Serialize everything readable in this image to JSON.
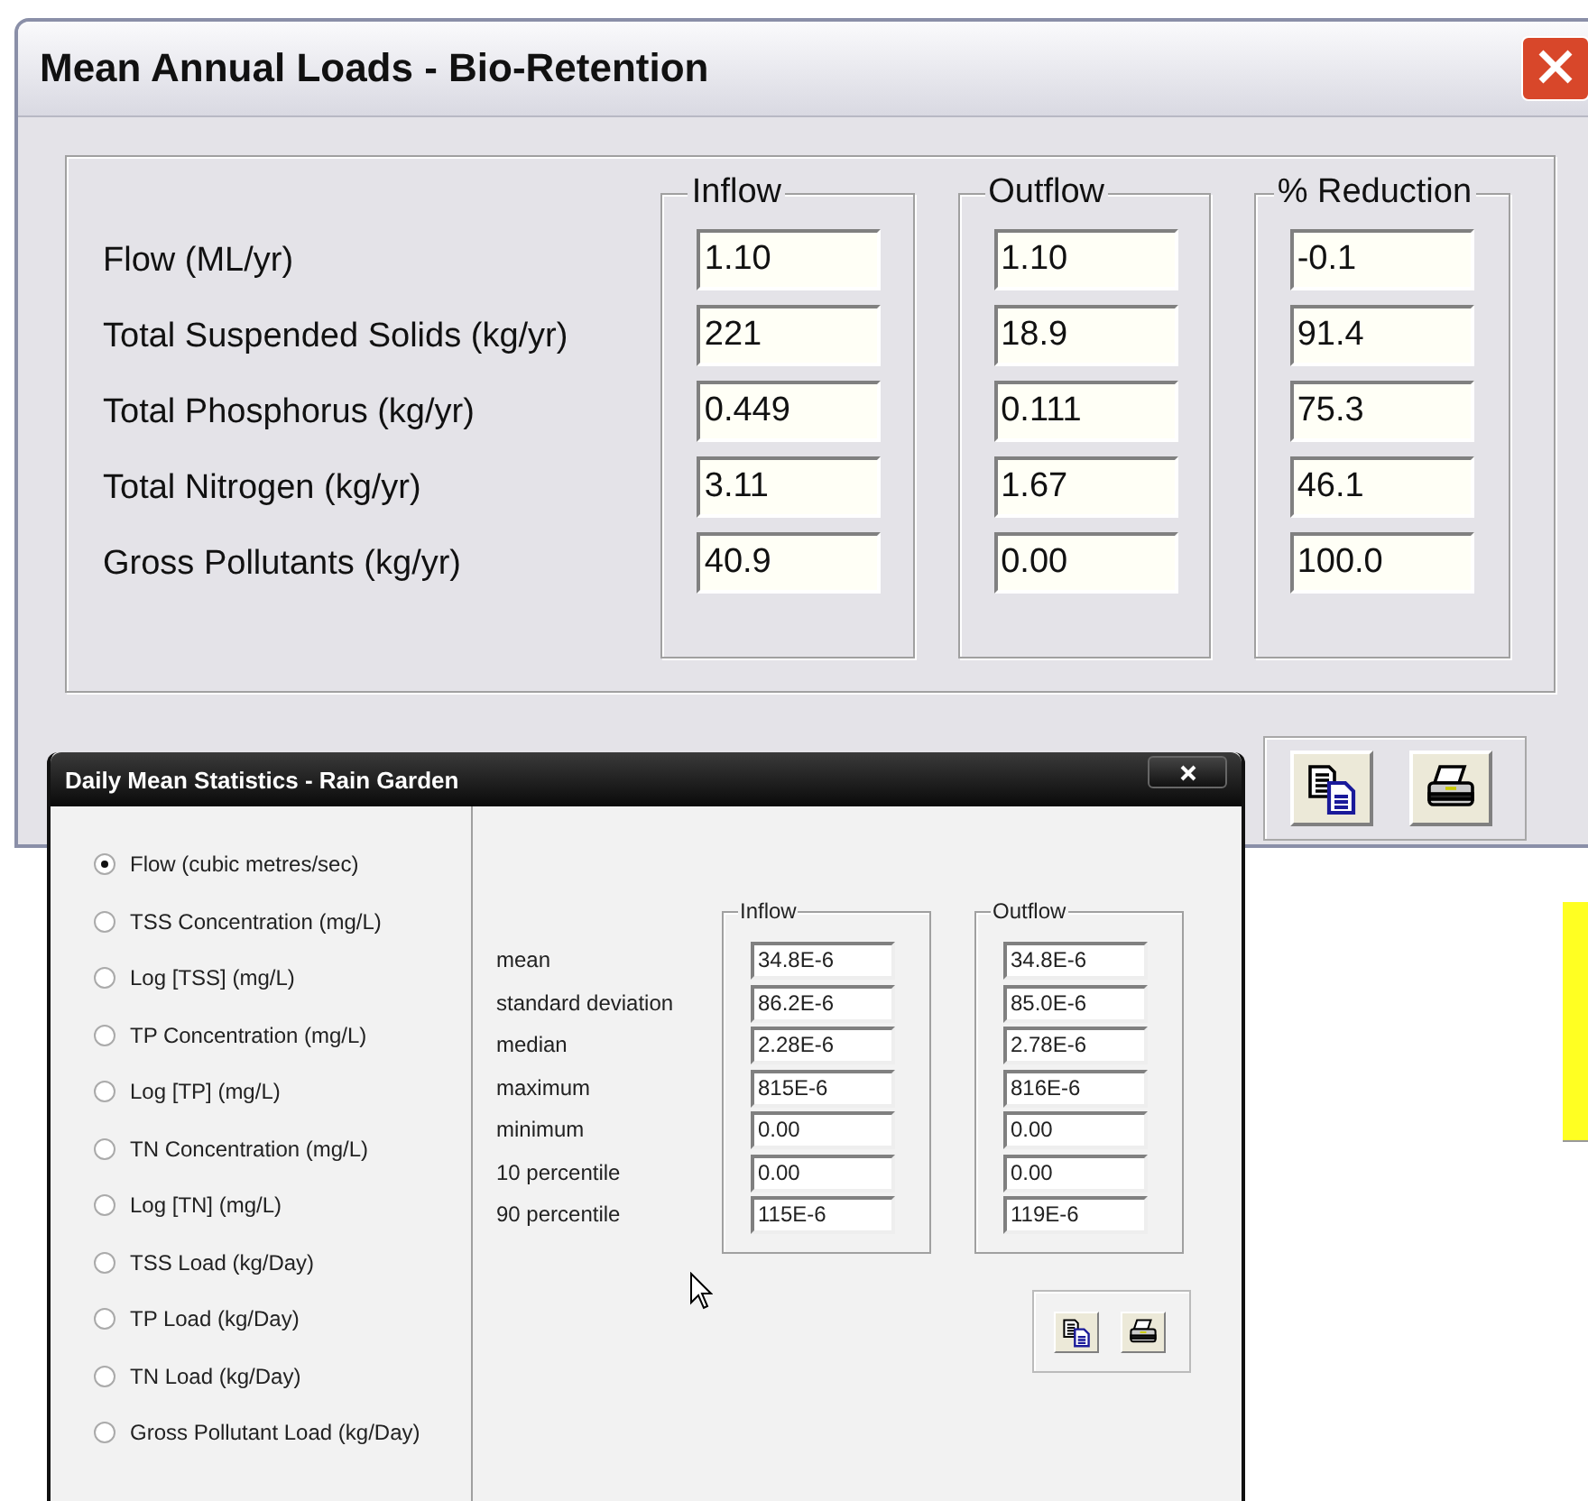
{
  "main_window": {
    "title": "Mean Annual Loads - Bio-Retention",
    "columns": [
      "Inflow",
      "Outflow",
      "% Reduction"
    ],
    "rows": [
      {
        "label": "Flow (ML/yr)",
        "values": [
          "1.10",
          "1.10",
          "-0.1"
        ]
      },
      {
        "label": "Total Suspended Solids (kg/yr)",
        "values": [
          "221",
          "18.9",
          "91.4"
        ]
      },
      {
        "label": "Total Phosphorus (kg/yr)",
        "values": [
          "0.449",
          "0.111",
          "75.3"
        ]
      },
      {
        "label": "Total Nitrogen (kg/yr)",
        "values": [
          "3.11",
          "1.67",
          "46.1"
        ]
      },
      {
        "label": "Gross Pollutants (kg/yr)",
        "values": [
          "40.9",
          "0.00",
          "100.0"
        ]
      }
    ],
    "buttons": [
      {
        "kind": "copy"
      },
      {
        "kind": "print"
      }
    ]
  },
  "stats_window": {
    "title": "Daily Mean Statistics - Rain Garden",
    "options": [
      {
        "label": "Flow (cubic metres/sec)",
        "selected": true
      },
      {
        "label": "TSS Concentration (mg/L)",
        "selected": false
      },
      {
        "label": "Log [TSS] (mg/L)",
        "selected": false
      },
      {
        "label": "TP Concentration (mg/L)",
        "selected": false
      },
      {
        "label": "Log [TP] (mg/L)",
        "selected": false
      },
      {
        "label": "TN Concentration (mg/L)",
        "selected": false
      },
      {
        "label": "Log [TN] (mg/L)",
        "selected": false
      },
      {
        "label": "TSS Load (kg/Day)",
        "selected": false
      },
      {
        "label": "TP Load (kg/Day)",
        "selected": false
      },
      {
        "label": "TN Load (kg/Day)",
        "selected": false
      },
      {
        "label": "Gross Pollutant Load (kg/Day)",
        "selected": false
      }
    ],
    "columns": [
      "Inflow",
      "Outflow"
    ],
    "rows": [
      {
        "label": "mean",
        "values": [
          "34.8E-6",
          "34.8E-6"
        ]
      },
      {
        "label": "standard deviation",
        "values": [
          "86.2E-6",
          "85.0E-6"
        ]
      },
      {
        "label": "median",
        "values": [
          "2.28E-6",
          "2.78E-6"
        ]
      },
      {
        "label": "maximum",
        "values": [
          "815E-6",
          "816E-6"
        ]
      },
      {
        "label": "minimum",
        "values": [
          "0.00",
          "0.00"
        ]
      },
      {
        "label": "10 percentile",
        "values": [
          "0.00",
          "0.00"
        ]
      },
      {
        "label": "90 percentile",
        "values": [
          "115E-6",
          "119E-6"
        ]
      }
    ],
    "buttons": [
      {
        "kind": "copy"
      },
      {
        "kind": "print"
      }
    ]
  }
}
